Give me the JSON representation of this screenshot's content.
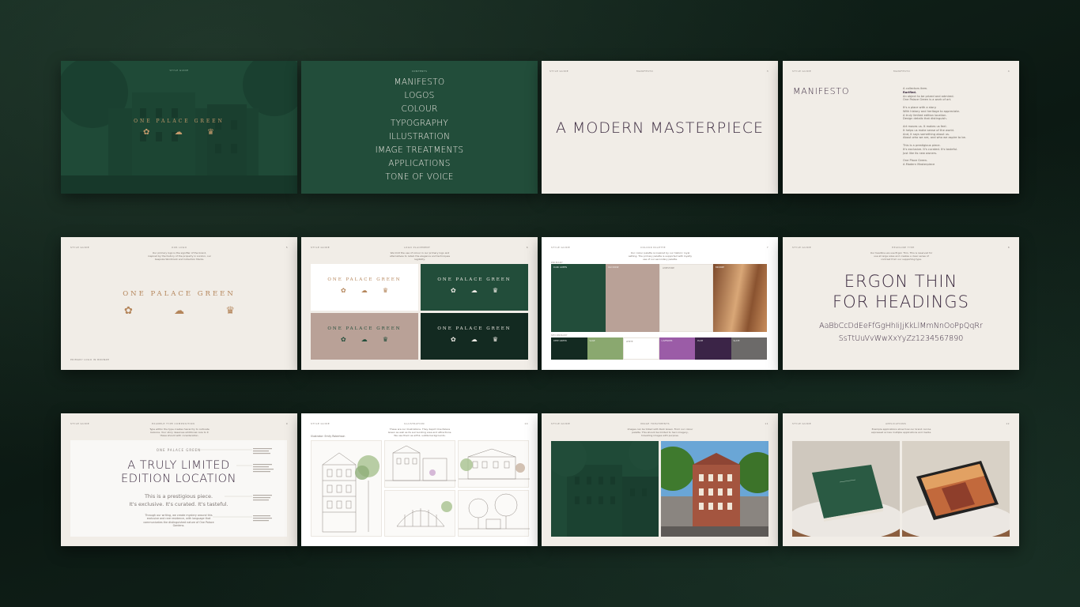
{
  "slide1": {
    "header": "STYLE GUIDE",
    "brand": "ONE PALACE GREEN"
  },
  "slide2": {
    "header": "CONTENTS",
    "items": [
      "MANIFESTO",
      "LOGOS",
      "COLOUR",
      "TYPOGRAPHY",
      "ILLUSTRATION",
      "IMAGE TREATMENTS",
      "APPLICATIONS",
      "TONE OF VOICE"
    ]
  },
  "slide3": {
    "header_left": "STYLE GUIDE",
    "header_mid": "MANIFESTO",
    "header_right": "3",
    "title": "A MODERN MASTERPIECE"
  },
  "slide4": {
    "header_left": "STYLE GUIDE",
    "header_mid": "MANIFESTO",
    "header_right": "4",
    "title": "MANIFESTO",
    "lines": [
      "A collectors item.",
      "Rarified.",
      "An object to be prized and admired.",
      "One Palace Green is a work of art.",
      "",
      "It's a place with a story.",
      "With history and heritage to appreciate.",
      "A truly limited edition location.",
      "Design details that distinguish.",
      "",
      "Art moves us. It makes us feel.",
      "It helps us make sense of the world.",
      "And, it says something about us.",
      "About who we are, and who we aspire to be.",
      "",
      "This is a prestigious piece.",
      "It's exclusive. It's curated. It's tasteful.",
      "Just like its new owners.",
      "",
      "One Place Green.",
      "A Modern Masterpiece"
    ]
  },
  "slide5": {
    "header_left": "STYLE GUIDE",
    "header_mid": "OUR LOGO",
    "header_right": "5",
    "intro": "Our primary logo is the signifier of the brand, inspired by the history of the property in London, our bespoke Wordmark and Collection Marks.",
    "brand": "ONE PALACE GREEN",
    "footer": "PRIMARY LOGO IN BRONZE"
  },
  "slide6": {
    "header_left": "STYLE GUIDE",
    "header_mid": "LOGO PLACEMENT",
    "header_right": "6",
    "intro": "We limit the use of colour in our primary logo and alternatives to retain the elegance and techniques legibility.",
    "panels": [
      {
        "brand": "ONE PALACE GREEN",
        "bg": "#ffffff",
        "fg": "#b4855a"
      },
      {
        "brand": "ONE PALACE GREEN",
        "bg": "#224d3a",
        "fg": "#f1ede7"
      },
      {
        "brand": "ONE PALACE GREEN",
        "bg": "#b9a197",
        "fg": "#224d3a"
      },
      {
        "brand": "ONE PALACE GREEN",
        "bg": "#132a21",
        "fg": "#f1ede7"
      }
    ]
  },
  "slide7": {
    "header_left": "STYLE GUIDE",
    "header_mid": "COLOUR PALETTE",
    "header_right": "7",
    "intro": "Our colour palette is inspired by our historic royal setting. The primary palette is supported with loyalty use of our secondary palette.",
    "primary_label": "PRIMARY",
    "secondary_label": "SECONDARY",
    "primary": [
      {
        "color": "#224d3a",
        "label": "DARK GREEN"
      },
      {
        "color": "#b9a197",
        "label": "OLD ROSE"
      },
      {
        "color": "#f1ede7",
        "label": "LIMESTONE"
      },
      {
        "color": "#b7794a",
        "label": "BRONZE"
      }
    ],
    "secondary": [
      {
        "color": "#132a21",
        "label": "DEEP GREEN"
      },
      {
        "color": "#8aa86f",
        "label": "SAGE"
      },
      {
        "color": "#ffffff",
        "label": "WHITE"
      },
      {
        "color": "#9b5ca7",
        "label": "LAVENDER"
      },
      {
        "color": "#3b2447",
        "label": "PLUM"
      },
      {
        "color": "#6c6a69",
        "label": "SLATE"
      }
    ]
  },
  "slide8": {
    "header_left": "STYLE GUIDE",
    "header_mid": "HEADLINE TYPE",
    "header_right": "8",
    "intro": "Our headline we use Ergon Thin. This is reserved for use at large sizes and creates a clear sense of contrast from our supporting type.",
    "title_line1": "ERGON THIN",
    "title_line2": "FOR HEADINGS",
    "alpha1": "AaBbCcDdEeFfGgHhIiJjKkLlMmNnOoPpQqRr",
    "alpha2": "SsTtUuVvWwXxYyZz1234567890"
  },
  "slide9": {
    "header_left": "STYLE GUIDE",
    "header_mid": "EXAMPLE TYPE COMPOSITION",
    "header_right": "9",
    "intro": "Type within the type creates hierarchy to cultivate balance. Your story deserves additional care to it these should with consideration.",
    "brand": "ONE PALACE GREEN",
    "title_line1": "A TRULY LIMITED",
    "title_line2": "EDITION LOCATION",
    "sub1": "This is a prestigious piece.",
    "sub2": "It's exclusive. It's curated. It's tasteful.",
    "body": "Through our writing, we create mystery around this exclusive and rare residence, with language that communicates the distinguished nature of One Palace Gardens."
  },
  "slide10": {
    "header_left": "STYLE GUIDE",
    "header_mid": "ILLUSTRATION",
    "header_right": "10",
    "intro": "These are our illustrations. They depict One Palace Green as well as its surrounding area and attractions. We use them as artful, subtle backgrounds.",
    "caption": "Illustrator: Emily Robertson"
  },
  "slide11": {
    "header_left": "STYLE GUIDE",
    "header_mid": "IMAGE TREATMENTS",
    "header_right": "11",
    "intro": "Images can be tinted with Dark Green. From our colour palette. This should be limited to hero imagery, travelling images with purpose."
  },
  "slide12": {
    "header_left": "STYLE GUIDE",
    "header_mid": "APPLICATIONS",
    "header_right": "12",
    "intro": "Example applications show how our brand can be expressed across multiple applications and media."
  },
  "colors": {
    "background": "#0f1f18",
    "dark_green": "#224d3a",
    "bronze": "#b4855a",
    "cream": "#f1ede7",
    "plum": "#3b2a3f"
  }
}
